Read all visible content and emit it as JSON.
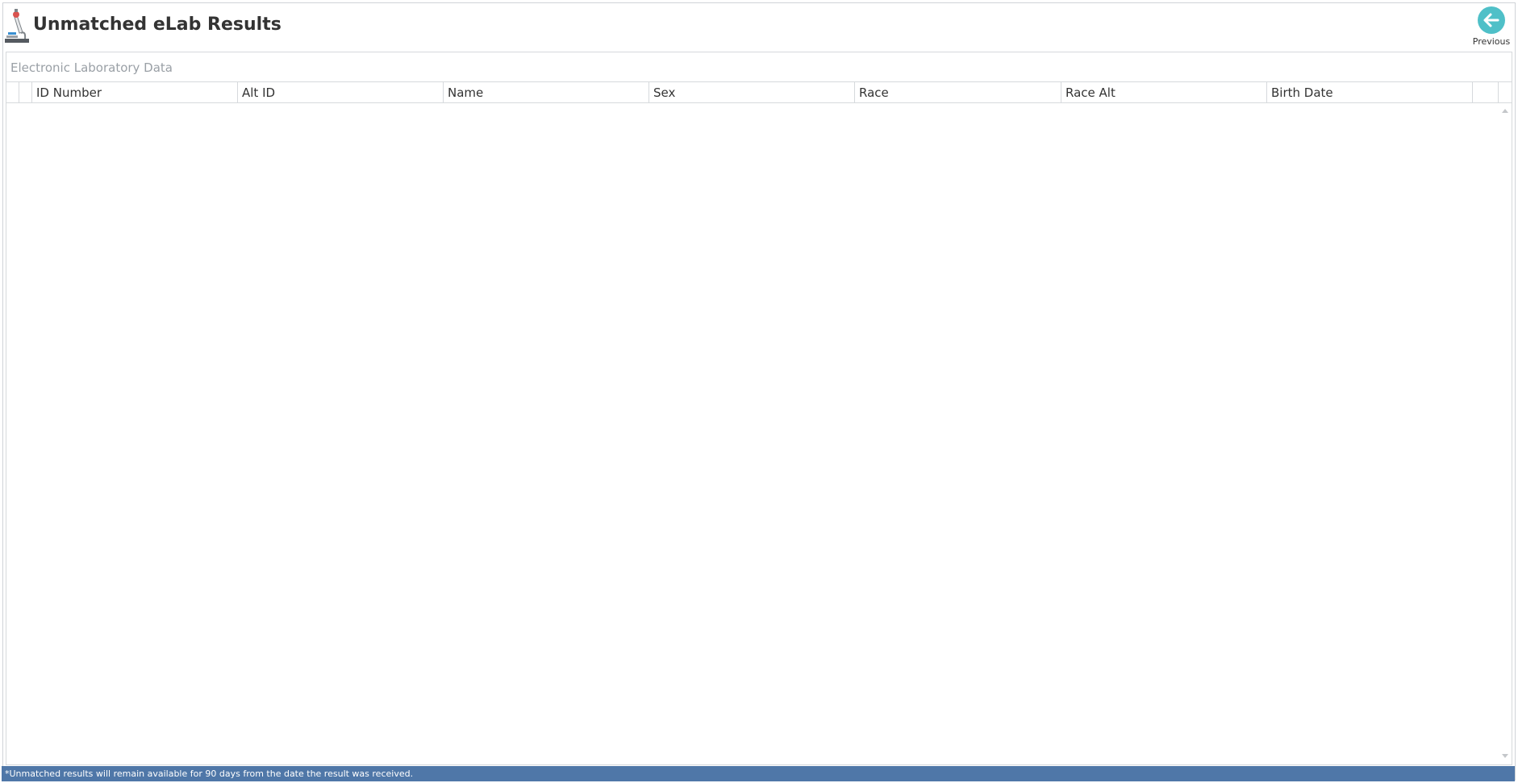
{
  "header": {
    "title": "Unmatched eLab Results",
    "app_icon": "microscope-icon",
    "previous_label": "Previous",
    "previous_icon": "arrow-left-icon",
    "previous_color": "#4fc0c8"
  },
  "panel": {
    "title": "Electronic Laboratory Data",
    "columns": [
      "ID Number",
      "Alt ID",
      "Name",
      "Sex",
      "Race",
      "Race Alt",
      "Birth Date"
    ],
    "rows": []
  },
  "footer": {
    "note": "*Unmatched results will remain available for 90 days from the date the result was received.",
    "background": "#4f77a8"
  }
}
